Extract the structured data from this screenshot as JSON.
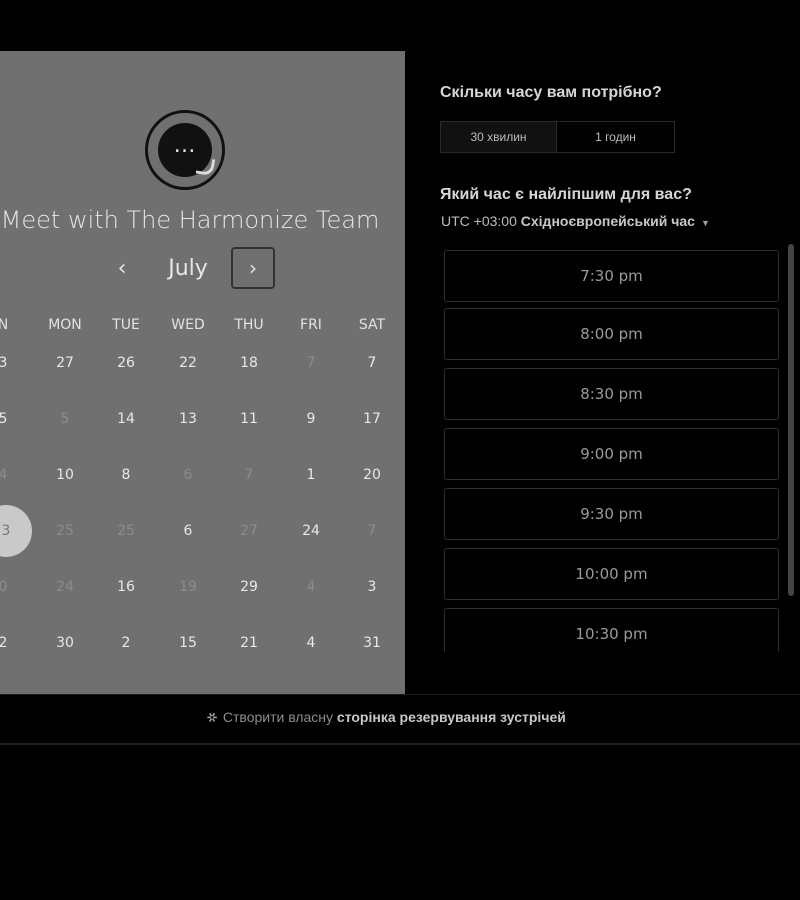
{
  "calendar": {
    "title": "Meet with The Harmonize Team",
    "month": "July",
    "prev": "‹",
    "next": "›",
    "weekdays": [
      "N",
      "MON",
      "TUE",
      "WED",
      "THU",
      "FRI",
      "SAT"
    ],
    "weeks": [
      [
        "3",
        "27",
        "26",
        "22",
        "18",
        "7",
        "7"
      ],
      [
        "5",
        "5",
        "14",
        "13",
        "11",
        "9",
        "17"
      ],
      [
        "4",
        "10",
        "8",
        "6",
        "7",
        "1",
        "20"
      ],
      [
        "3",
        "25",
        "25",
        "6",
        "27",
        "24",
        "7"
      ],
      [
        "0",
        "24",
        "16",
        "19",
        "29",
        "4",
        "3"
      ],
      [
        "2",
        "30",
        "2",
        "15",
        "21",
        "4",
        "31"
      ]
    ],
    "muted": [
      [
        false,
        false,
        false,
        false,
        false,
        true,
        false
      ],
      [
        false,
        true,
        false,
        false,
        false,
        false,
        false
      ],
      [
        true,
        false,
        false,
        true,
        true,
        false,
        false
      ],
      [
        false,
        true,
        true,
        false,
        true,
        false,
        true
      ],
      [
        true,
        true,
        false,
        true,
        false,
        true,
        false
      ],
      [
        false,
        false,
        false,
        false,
        false,
        false,
        false
      ]
    ],
    "selected": {
      "row": 3,
      "col": 0
    }
  },
  "booking": {
    "duration_question": "Скільки часу вам потрібно?",
    "durations": [
      "30 хвилин",
      "1 годин"
    ],
    "time_question": "Який час є найліпшим для вас?",
    "timezone_offset": "UTC +03:00",
    "timezone_name": "Східноєвропейський час",
    "slots": [
      "7:30 pm",
      "8:00 pm",
      "8:30 pm",
      "9:00 pm",
      "9:30 pm",
      "10:00 pm",
      "10:30 pm"
    ]
  },
  "footer": {
    "prefix": "Створити власну",
    "link": "сторінка резервування зустрічей"
  },
  "icons": {
    "logo": "chat-bubble-icon",
    "caret": "caret-down-icon",
    "footer": "hubspot-sprocket-icon"
  }
}
